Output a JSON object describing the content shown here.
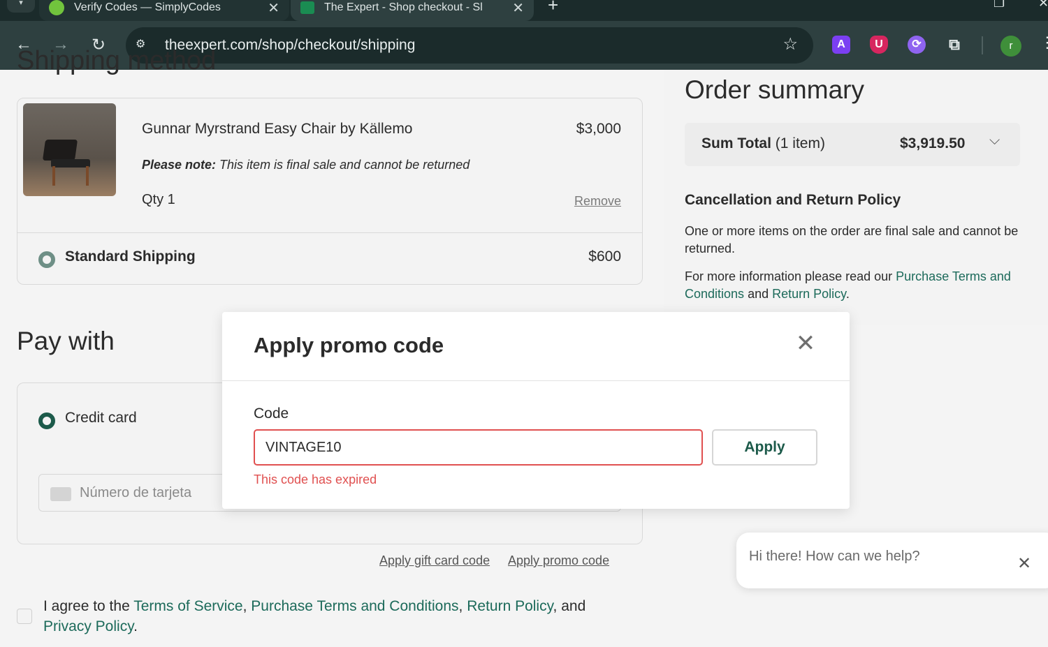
{
  "browser": {
    "tabs": [
      {
        "title": "Verify Codes — SimplyCodes",
        "close": "✕"
      },
      {
        "title": "The Expert - Shop checkout - Sl",
        "close": "✕"
      }
    ],
    "new_tab": "+",
    "url": "theexpert.com/shop/checkout/shipping",
    "profile_initial": "r",
    "ext_a": "A",
    "ext_shield": "U"
  },
  "shipping": {
    "heading": "Shipping method",
    "product": {
      "name": "Gunnar Myrstrand Easy Chair by Källemo",
      "price": "$3,000",
      "note_label": "Please note:",
      "note_text": " This item is final sale and cannot be returned",
      "qty": "Qty 1",
      "remove": "Remove"
    },
    "method": {
      "label": "Standard Shipping",
      "price": "$600"
    }
  },
  "payment": {
    "heading": "Pay with",
    "option": "Credit card",
    "card_placeholder": "Número de tarjeta",
    "gift_link": "Apply gift card code",
    "promo_link": "Apply promo code"
  },
  "terms": {
    "prefix": "I agree to the ",
    "tos": "Terms of Service",
    "sep1": ", ",
    "purchase": "Purchase Terms and Conditions",
    "sep2": ", ",
    "return": "Return Policy",
    "sep3": ", and ",
    "privacy": "Privacy Policy",
    "end": "."
  },
  "summary": {
    "title": "Order summary",
    "sum_label": "Sum Total",
    "sum_count": " (1 item)",
    "sum_value": "$3,919.50",
    "policy_title": "Cancellation and Return Policy",
    "policy_p1": "One or more items on the order are final sale and cannot be returned.",
    "policy_p2_prefix": "For more information please read our ",
    "policy_p2_link1": "Purchase Terms and Conditions",
    "policy_p2_mid": " and ",
    "policy_p2_link2": "Return Policy",
    "policy_p2_end": "."
  },
  "modal": {
    "title": "Apply promo code",
    "code_label": "Code",
    "code_value": "VINTAGE10",
    "apply": "Apply",
    "error": "This code has expired",
    "accent_color": "#1c5a4a",
    "error_color": "#e05050"
  },
  "chat": {
    "text": "Hi there! How can we help?"
  }
}
